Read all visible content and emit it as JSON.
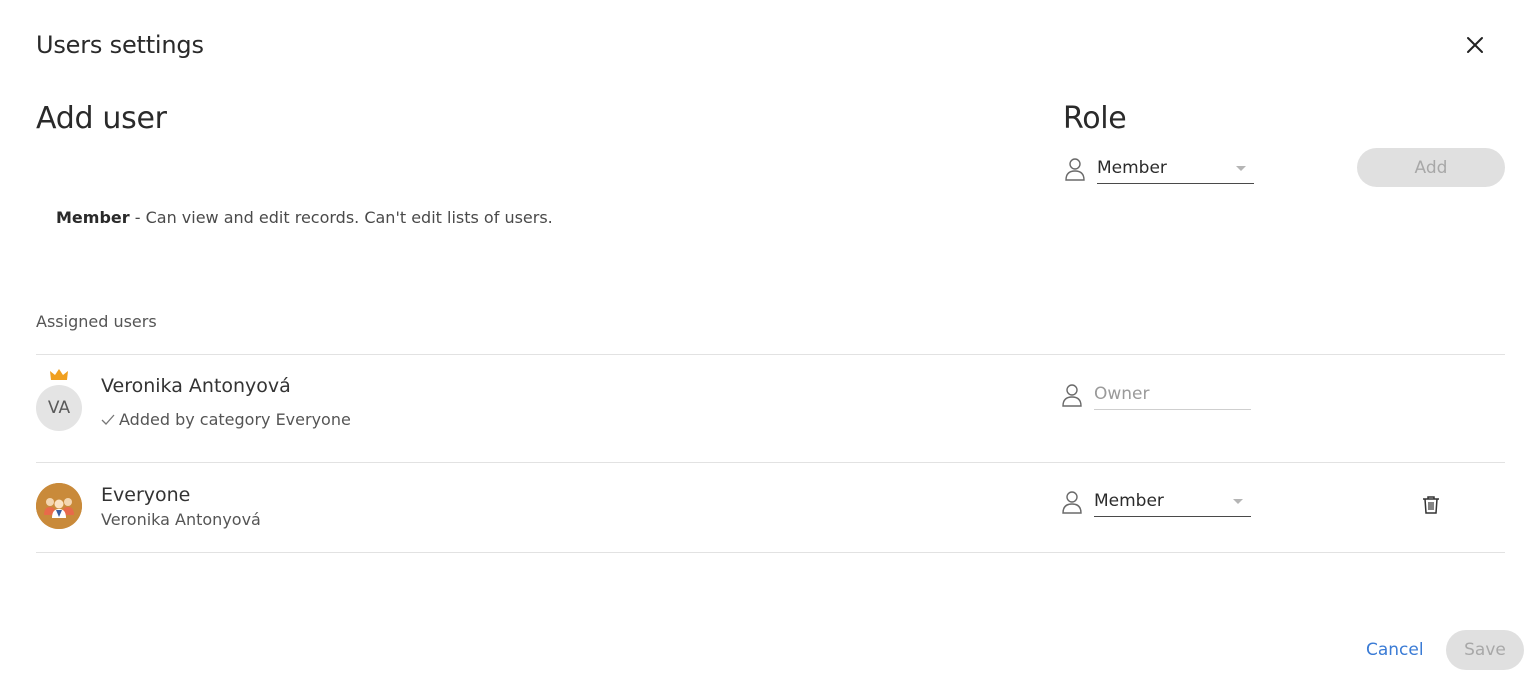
{
  "dialog": {
    "title": "Users settings",
    "close_icon": "close-icon"
  },
  "add_user": {
    "title": "Add user",
    "role_title": "Role",
    "role_select": {
      "value": "Member",
      "icon": "person-icon"
    },
    "add_label": "Add",
    "role_description": {
      "role": "Member",
      "text": " - Can view and edit records. Can't edit lists of users."
    }
  },
  "assigned": {
    "label": "Assigned users",
    "users": [
      {
        "initials": "VA",
        "name": "Veronika Antonyová",
        "sub": "Added by category Everyone",
        "owner_badge": "crown-icon",
        "role": "Owner",
        "role_editable": false
      },
      {
        "initials": "",
        "name": "Everyone",
        "sub": "Veronika Antonyová",
        "avatar_icon": "group-avatar-icon",
        "role": "Member",
        "role_editable": true,
        "delete_icon": "trash-icon"
      }
    ]
  },
  "footer": {
    "cancel_label": "Cancel",
    "save_label": "Save"
  },
  "colors": {
    "accent": "#3a7bd5",
    "disabled_bg": "#e0e0e0",
    "disabled_text": "#a8a8a8",
    "crown": "#f0a020",
    "group_avatar": "#c98a3a"
  }
}
